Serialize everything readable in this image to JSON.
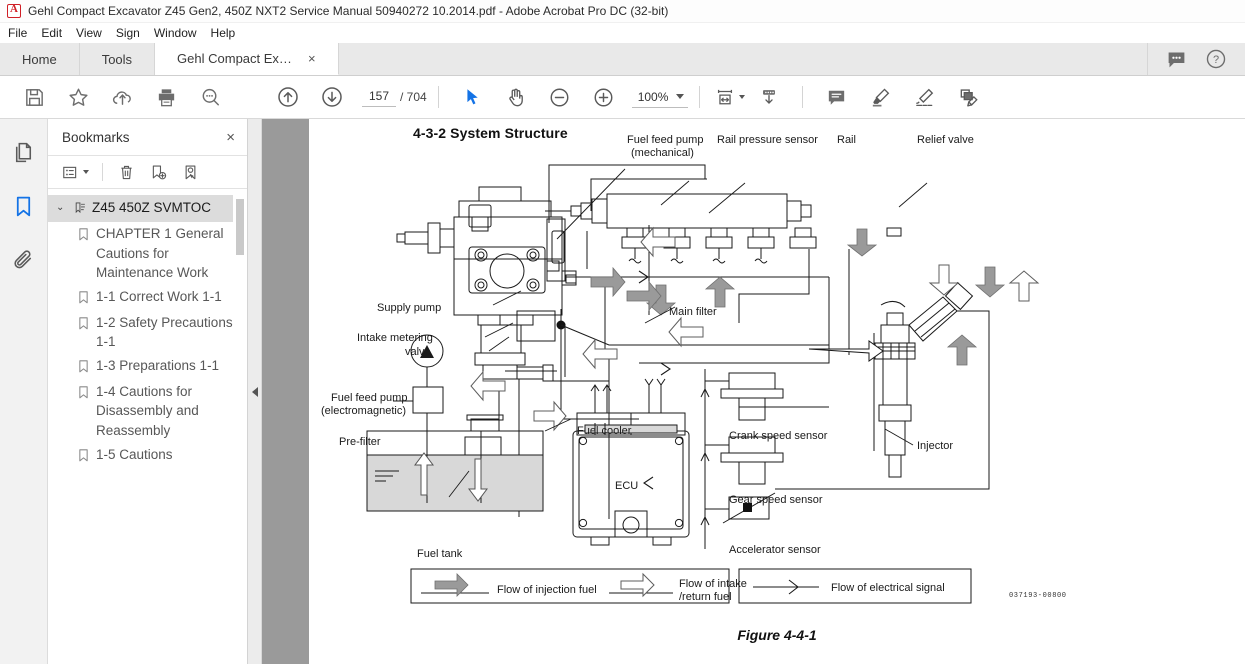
{
  "window": {
    "title": "Gehl Compact Excavator Z45 Gen2, 450Z NXT2 Service Manual 50940272 10.2014.pdf - Adobe Acrobat Pro DC (32-bit)",
    "logo": "acrobat-logo"
  },
  "menubar": {
    "items": [
      {
        "label": "File"
      },
      {
        "label": "Edit"
      },
      {
        "label": "View"
      },
      {
        "label": "Sign"
      },
      {
        "label": "Window"
      },
      {
        "label": "Help"
      }
    ]
  },
  "tabs": {
    "home": "Home",
    "tools": "Tools",
    "document": "Gehl Compact Exca...",
    "close": "×",
    "right_icons": [
      "comment-icon",
      "help-icon"
    ]
  },
  "toolbar": {
    "left_icons": [
      "save-icon",
      "star-icon",
      "upload-cloud-icon",
      "print-icon",
      "search-icon"
    ],
    "nav_icons": [
      "previous-page-icon",
      "next-page-icon"
    ],
    "page_current": "157",
    "page_total": "/ 704",
    "tool_icons": [
      "select-cursor-icon",
      "hand-tool-icon",
      "zoom-out-icon",
      "zoom-in-icon"
    ],
    "zoom_value": "100%",
    "right_icons": [
      "fit-page-icon",
      "scroll-mode-icon",
      "comment-icon",
      "highlight-icon",
      "sign-icon",
      "edit-pdf-icon"
    ]
  },
  "rail": {
    "items": [
      {
        "name": "page-thumbnails-icon",
        "active": false
      },
      {
        "name": "bookmarks-icon",
        "active": true
      },
      {
        "name": "attachments-icon",
        "active": false
      }
    ]
  },
  "panel": {
    "title": "Bookmarks",
    "close": "×",
    "tools": [
      "bookmark-options-icon",
      "delete-bookmark-icon",
      "new-bookmark-icon",
      "select-bookmark-icon"
    ],
    "root": {
      "label": "Z45 450Z SVMTOC",
      "expanded": true,
      "twisty": "⌄"
    },
    "items": [
      {
        "label": "CHAPTER 1 General Cautions for Maintenance Work"
      },
      {
        "label": "1-1 Correct Work 1-1"
      },
      {
        "label": "1-2 Safety Precautions 1-1"
      },
      {
        "label": "1-3 Preparations 1-1"
      },
      {
        "label": "1-4 Cautions for Disassembly and Reassembly"
      },
      {
        "label": "1-5 Cautions"
      }
    ]
  },
  "document": {
    "heading": "4-3-2  System Structure",
    "figure_caption": "Figure 4-4-1",
    "drawing_id": "037193-00800",
    "labels": {
      "fuel_feed_pump_mech_1": "Fuel feed pump",
      "fuel_feed_pump_mech_2": "(mechanical)",
      "rail_pressure_sensor": "Rail pressure sensor",
      "rail": "Rail",
      "relief_valve": "Relief valve",
      "supply_pump": "Supply pump",
      "intake_metering_1": "Intake metering",
      "intake_metering_2": "valve",
      "main_filter": "Main filter",
      "fuel_feed_pump_elec_1": "Fuel feed pump",
      "fuel_feed_pump_elec_2": "(electromagnetic)",
      "pre_filter": "Pre-filter",
      "fuel_cooler": "Fuel cooler",
      "fuel_tank": "Fuel tank",
      "ecu": "ECU",
      "crank_speed_sensor": "Crank speed sensor",
      "gear_speed_sensor": "Gear speed sensor",
      "accelerator_sensor": "Accelerator sensor",
      "injector": "Injector"
    },
    "legend": {
      "injection_fuel": "Flow of injection fuel",
      "intake_return_1": "Flow of intake",
      "intake_return_2": "/return fuel",
      "electrical_signal": "Flow of electrical signal"
    }
  },
  "colors": {
    "accent": "#1473e6",
    "tab_active": "#ffffff",
    "tab_strip": "#e9e9e9",
    "panel_selection": "#dcdcdc",
    "page_gutter": "#9a9a9a",
    "icon_gray": "#6d6d6d"
  }
}
